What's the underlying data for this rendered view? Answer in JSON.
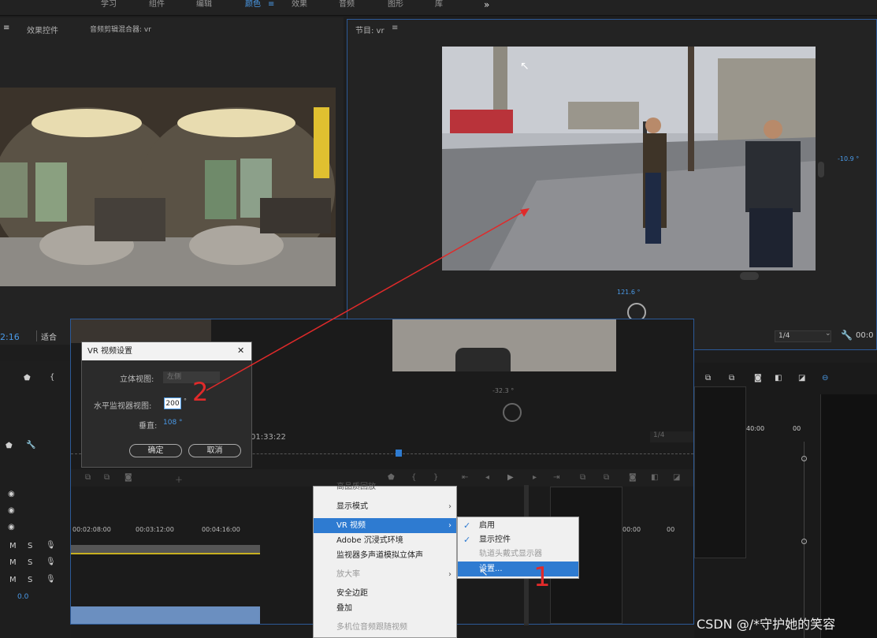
{
  "workspaces": [
    "学习",
    "组件",
    "编辑",
    "颜色",
    "效果",
    "音频",
    "图形",
    "库"
  ],
  "more_icon": "»",
  "source_panel": {
    "tabs": [
      "效果控件",
      "音频剪辑混合器: vr"
    ],
    "timecode": "2:16",
    "fit": "适合"
  },
  "program_panel": {
    "title": "节目: vr",
    "menu_icon": "≡",
    "vertical_angle": "-10.9 °",
    "horizontal_angle": "121.6 °",
    "resolution": "1/4"
  },
  "overlay_panel": {
    "angle": "-32.3 °",
    "timecode": "01:33:22",
    "resolution": "1/4",
    "ruler": [
      "00:02:08:00",
      "00:03:12:00",
      "00:04:16:00"
    ],
    "right_ruler": [
      "40:00",
      "00",
      "00:00",
      "00"
    ],
    "audio_level": "0.0"
  },
  "vr_dialog": {
    "title": "VR 视频设置",
    "close": "✕",
    "stereo_label": "立体视图:",
    "stereo_value": "左侧",
    "horizontal_label": "水平监视器视图:",
    "horizontal_value": "200",
    "degree": "°",
    "vertical_label": "垂直:",
    "vertical_value": "108 °",
    "ok": "确定",
    "cancel": "取消"
  },
  "context_menu": {
    "top_partial": "高品质回放",
    "items": [
      {
        "label": "显示模式",
        "arrow": "›"
      },
      {
        "label": "VR 视频",
        "arrow": "›"
      },
      {
        "label": "Adobe 沉浸式环境",
        "arrow": ""
      },
      {
        "label": "监视器多声道模拟立体声",
        "arrow": ""
      },
      {
        "label": "放大率",
        "arrow": "›"
      },
      {
        "label": "安全边距",
        "arrow": ""
      },
      {
        "label": "叠加",
        "arrow": ""
      },
      {
        "label": "多机位音频跟随视频",
        "arrow": ""
      }
    ]
  },
  "vr_submenu": {
    "items": [
      "启用",
      "显示控件",
      "轨道头戴式显示器",
      "设置..."
    ],
    "check": "✓"
  },
  "annotations": {
    "step1": "1",
    "step2": "2"
  },
  "timeline_left": {
    "m": "M",
    "s": "S"
  },
  "watermark": "CSDN @/*守护她的笑容",
  "colors": {
    "accent": "#2c5a98",
    "selection": "#2e7bd1",
    "annotation": "#e02a2a",
    "timecode": "#4a9ae8"
  }
}
